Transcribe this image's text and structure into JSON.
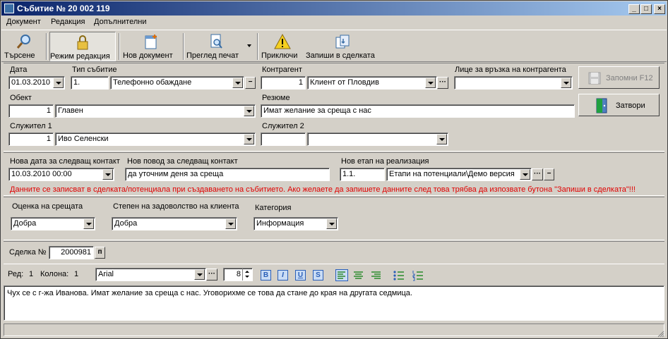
{
  "window": {
    "title": "Събитие № 20 002 119",
    "btn_min": "_",
    "btn_max": "□",
    "btn_close": "×"
  },
  "menu": [
    "Документ",
    "Редакция",
    "Допълнителни"
  ],
  "toolbar": {
    "search": "Търсене",
    "edit_mode": "Режим редакция",
    "new_doc": "Нов документ",
    "print_preview": "Преглед печат",
    "finish": "Приключи",
    "save_deal": "Запиши в сделката"
  },
  "labels": {
    "date": "Дата",
    "event_type": "Тип събитие",
    "counterparty": "Контрагент",
    "contact_person": "Лице за връзка на контрагента",
    "object": "Обект",
    "summary": "Резюме",
    "employee1": "Служител 1",
    "employee2": "Служител 2",
    "next_contact_date": "Нова дата за следващ контакт",
    "next_contact_reason": "Нов повод за следващ контакт",
    "next_stage": "Нов етап на реализация",
    "meeting_rating": "Оценка на срещата",
    "satisfaction": "Степен на задоволство на клиента",
    "category": "Категория",
    "deal_no": "Сделка №",
    "row": "Ред:",
    "col": "Колона:"
  },
  "values": {
    "date": "01.03.2010",
    "event_type_code": "1.",
    "event_type": "Телефонно обаждане",
    "counterparty_code": "1",
    "counterparty": "Клиент от Пловдив",
    "contact_person": "",
    "object_code": "1",
    "object": "Главен",
    "summary": "Имат желание за среща с нас",
    "employee1_code": "1",
    "employee1": "Иво Селенски",
    "employee2_code": "",
    "employee2": "",
    "next_contact_date": "10.03.2010 00:00",
    "next_contact_reason": "да уточним деня за среща",
    "next_stage_code": "1.1.",
    "next_stage": "Етапи на потенциали\\Демо версия",
    "meeting_rating": "Добра",
    "satisfaction": "Добра",
    "category": "Информация",
    "deal_no": "2000981",
    "row": "1",
    "col": "1",
    "font": "Arial",
    "font_size": "8",
    "memo": "Чух се с г-жа Иванова. Имат желание за среща с нас. Уговорихме се това да стане до края на другата седмица."
  },
  "buttons": {
    "save_f12": "Запомни  F12",
    "close": "Затвори",
    "ellipsis": "···",
    "minus": "−",
    "deal_pick": "п"
  },
  "warning": "Данните се записват в сделката/потенциала при създаването на събитието. Ако желаете да запишете данните след това трябва да изпозвате бутона \"Запиши в сделката\"!!!",
  "format_buttons": {
    "bold": "B",
    "italic": "I",
    "underline": "U",
    "strike": "S"
  },
  "colors": {
    "face": "#d4d0c8",
    "title_start": "#0a246a",
    "title_end": "#a6caf0",
    "warning": "#e00000"
  }
}
